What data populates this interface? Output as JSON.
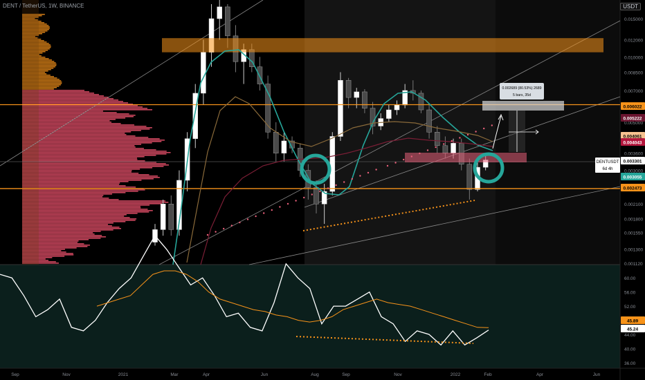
{
  "header": {
    "symbol_line": "DENT / TetherUS, 1W, BINANCE",
    "currency_badge": "USDT"
  },
  "colors": {
    "bg": "#000000",
    "rsi_bg": "#0b1f1c",
    "up": "#ffffff",
    "down": "#4a4a4a",
    "orange": "#f7931a",
    "teal": "#26a69a",
    "pink": "#e8607a",
    "profile": "#e04e67",
    "grey": "#6b6b6b"
  },
  "price_axis": {
    "ticks": [
      "0.015000",
      "0.012000",
      "0.010000",
      "0.008500",
      "0.007000",
      "0.005000",
      "0.004200",
      "0.003600",
      "0.003000",
      "0.002550",
      "0.002100",
      "0.001800",
      "0.001550",
      "0.001300",
      "0.001120"
    ],
    "labels": [
      {
        "value": "0.006022",
        "bg": "#f7931a",
        "fg": "#000000"
      },
      {
        "value": "0.005222",
        "bg": "#6b1530",
        "fg": "#ffffff"
      },
      {
        "value": "0.004061",
        "bg": "#f7c290",
        "fg": "#000000"
      },
      {
        "value": "0.004043",
        "bg": "#b4163d",
        "fg": "#ffffff"
      },
      {
        "value": "0.003301",
        "bg": "#ffffff",
        "fg": "#000000"
      },
      {
        "value": "0.003055",
        "bg": "#26a69a",
        "fg": "#ffffff"
      },
      {
        "value": "0.002473",
        "bg": "#f7931a",
        "fg": "#000000"
      }
    ],
    "symbol_tag": {
      "name": "DENTUSDT",
      "countdown": "6d 4h"
    }
  },
  "rsi_axis": {
    "ticks": [
      "60.00",
      "56.00",
      "52.00",
      "48.00",
      "44.00",
      "40.00",
      "36.00"
    ],
    "labels": [
      {
        "value": "45.89",
        "bg": "#f7931a",
        "fg": "#000000"
      },
      {
        "value": "45.24",
        "bg": "#ffffff",
        "fg": "#000000"
      }
    ]
  },
  "time_axis": [
    "Sep",
    "Nov",
    "2021",
    "Mar",
    "Apr",
    "Jun",
    "Aug",
    "Sep",
    "Nov",
    "2022",
    "Feb",
    "Apr",
    "Jun"
  ],
  "measure_box": {
    "line1": "0.002689 (80.53%) 2689",
    "line2": "5 bars, 35d"
  },
  "chart_data": {
    "type": "candlestick",
    "levels": {
      "resistance": 0.006022,
      "support": 0.002473,
      "zone_low": 0.0105,
      "zone_high": 0.0122
    },
    "candles": [
      [
        0.0014,
        0.0017,
        0.00135,
        0.0016
      ],
      [
        0.0016,
        0.0022,
        0.0015,
        0.0021
      ],
      [
        0.0021,
        0.0023,
        0.0015,
        0.0016
      ],
      [
        0.0016,
        0.003,
        0.0015,
        0.0027
      ],
      [
        0.0027,
        0.0045,
        0.0024,
        0.0042
      ],
      [
        0.0042,
        0.0075,
        0.0038,
        0.0068
      ],
      [
        0.0068,
        0.012,
        0.006,
        0.0105
      ],
      [
        0.0105,
        0.0175,
        0.009,
        0.015
      ],
      [
        0.015,
        0.019,
        0.012,
        0.017
      ],
      [
        0.017,
        0.0175,
        0.011,
        0.0125
      ],
      [
        0.0125,
        0.014,
        0.0085,
        0.0095
      ],
      [
        0.0095,
        0.0115,
        0.0075,
        0.0108
      ],
      [
        0.0108,
        0.0115,
        0.0085,
        0.009
      ],
      [
        0.009,
        0.01,
        0.007,
        0.0075
      ],
      [
        0.0075,
        0.0082,
        0.0042,
        0.0045
      ],
      [
        0.0045,
        0.005,
        0.0033,
        0.0036
      ],
      [
        0.0036,
        0.0045,
        0.0033,
        0.0041
      ],
      [
        0.0041,
        0.0043,
        0.0036,
        0.0038
      ],
      [
        0.0038,
        0.004,
        0.0028,
        0.003
      ],
      [
        0.003,
        0.0032,
        0.0022,
        0.0025
      ],
      [
        0.0025,
        0.0027,
        0.0019,
        0.0021
      ],
      [
        0.0021,
        0.0026,
        0.0017,
        0.0024
      ],
      [
        0.0024,
        0.0045,
        0.0023,
        0.0043
      ],
      [
        0.0043,
        0.0085,
        0.0041,
        0.0078
      ],
      [
        0.0078,
        0.008,
        0.0058,
        0.0065
      ],
      [
        0.0065,
        0.0072,
        0.0058,
        0.0069
      ],
      [
        0.0069,
        0.0071,
        0.0055,
        0.0058
      ],
      [
        0.0058,
        0.0062,
        0.0044,
        0.0048
      ],
      [
        0.0048,
        0.0055,
        0.0046,
        0.0052
      ],
      [
        0.0052,
        0.006,
        0.005,
        0.0057
      ],
      [
        0.0057,
        0.0063,
        0.0054,
        0.006
      ],
      [
        0.006,
        0.0075,
        0.0058,
        0.007
      ],
      [
        0.007,
        0.0078,
        0.0063,
        0.0068
      ],
      [
        0.0068,
        0.007,
        0.0055,
        0.0057
      ],
      [
        0.0057,
        0.006,
        0.0042,
        0.0045
      ],
      [
        0.0045,
        0.0048,
        0.0036,
        0.0039
      ],
      [
        0.0039,
        0.0043,
        0.0034,
        0.0036
      ],
      [
        0.0036,
        0.0042,
        0.0034,
        0.004
      ],
      [
        0.004,
        0.0042,
        0.003,
        0.0032
      ],
      [
        0.0032,
        0.0034,
        0.0022,
        0.00245
      ],
      [
        0.00245,
        0.0034,
        0.0024,
        0.0031
      ],
      [
        0.0031,
        0.0035,
        0.003,
        0.00335
      ]
    ],
    "rsi": [
      61,
      60,
      55,
      49,
      51,
      54,
      46,
      45,
      48,
      53,
      57,
      60,
      66,
      72,
      68,
      63,
      58,
      60,
      55,
      49,
      50,
      46,
      45,
      53,
      64,
      60,
      57,
      47,
      52,
      52,
      54,
      56,
      49,
      47,
      42,
      45,
      44,
      41,
      45,
      41,
      43,
      45.24
    ],
    "rsi_ma": [
      52,
      53,
      54,
      55,
      58,
      61,
      62,
      62,
      61,
      59,
      56,
      54,
      53,
      52,
      51,
      50.5,
      49.5,
      49,
      48,
      47.5,
      48,
      49,
      51,
      52,
      53,
      54,
      53,
      52.5,
      52,
      51,
      50,
      49,
      48,
      47,
      46,
      45.89
    ]
  }
}
